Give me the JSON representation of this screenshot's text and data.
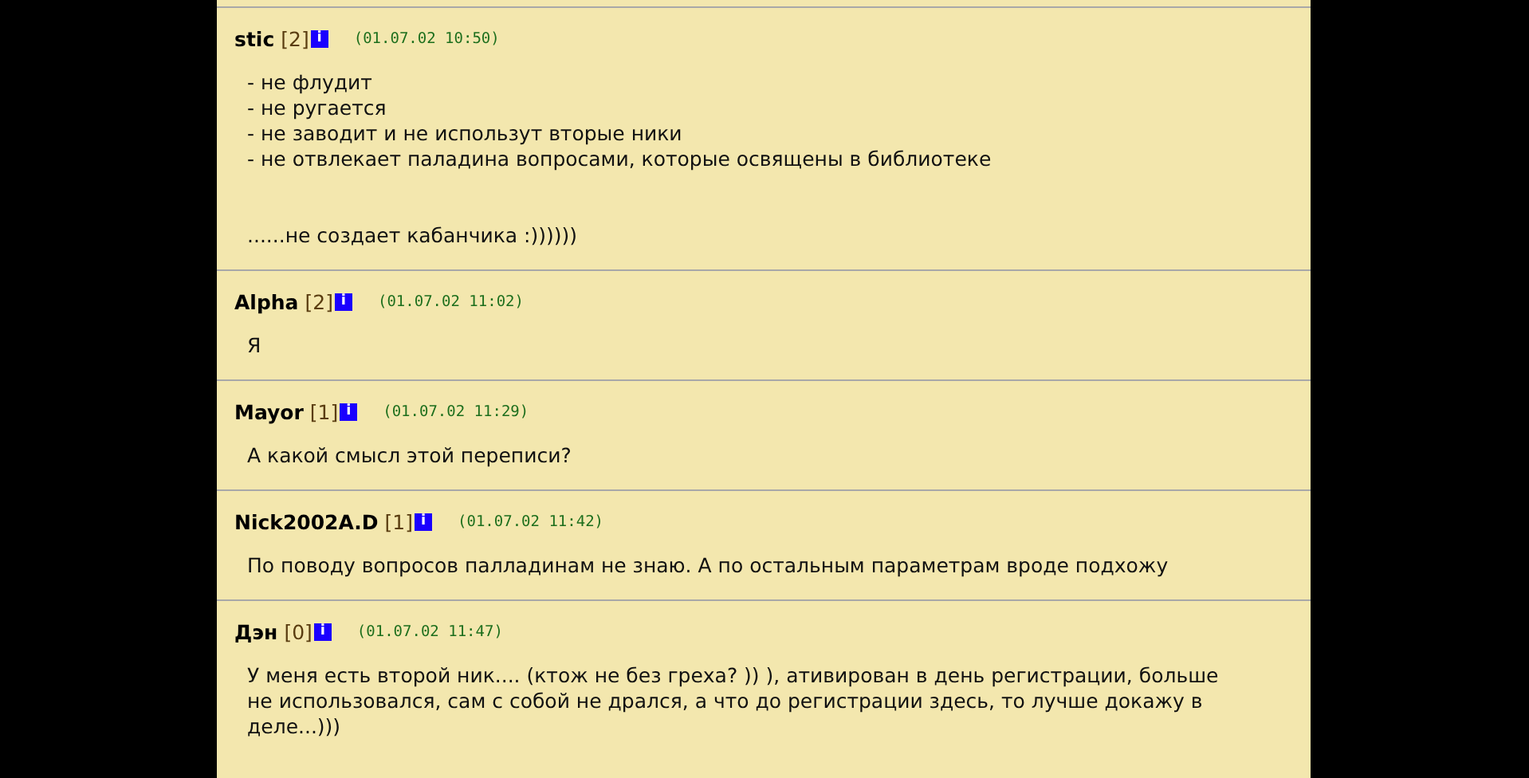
{
  "posts": [
    {
      "author": "stic",
      "rank": "[2]",
      "info": "i",
      "date": "(01.07.02 10:50)",
      "paragraphs": [
        [
          "- не флудит",
          "- не ругается",
          "- не заводит и не использут вторые ники",
          "- не отвлекает паладина вопросами, которые освящены в библиотеке"
        ],
        [
          "......не создает кабанчика :))))))"
        ]
      ]
    },
    {
      "author": "Alpha",
      "rank": "[2]",
      "info": "i",
      "date": "(01.07.02 11:02)",
      "paragraphs": [
        [
          "Я"
        ]
      ]
    },
    {
      "author": "Mayor",
      "rank": "[1]",
      "info": "i",
      "date": "(01.07.02 11:29)",
      "paragraphs": [
        [
          "А какой смысл этой переписи?"
        ]
      ]
    },
    {
      "author": "Nick2002A.D",
      "rank": "[1]",
      "info": "i",
      "date": "(01.07.02 11:42)",
      "paragraphs": [
        [
          "По поводу вопросов палладинам не знаю. А по остальным параметрам вроде подхожу"
        ]
      ]
    },
    {
      "author": "Дэн",
      "rank": "[0]",
      "info": "i",
      "date": "(01.07.02 11:47)",
      "paragraphs": [
        [
          "У меня есть второй ник.... (ктож не без греха? )) ), ативирован в день регистрации, больше",
          "не использовался, сам с собой не дрался, а что до регистрации здесь, то лучше докажу в",
          "деле...)))"
        ]
      ]
    }
  ]
}
